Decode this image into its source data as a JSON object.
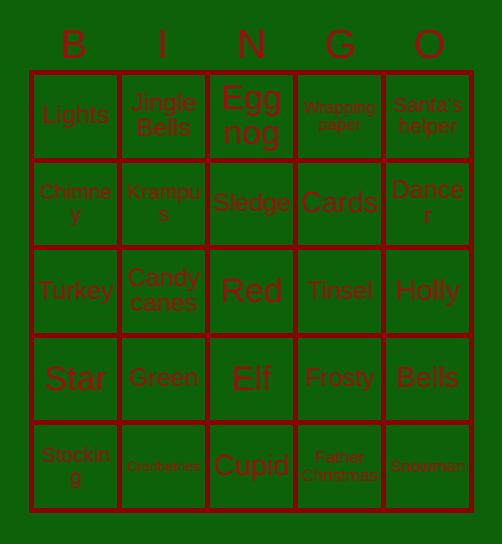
{
  "card": {
    "title": "BINGO",
    "background_color": "#0c6109",
    "border_color": "#8b0000",
    "text_color": "#9b0f0f"
  },
  "header": {
    "letters": [
      "B",
      "I",
      "N",
      "G",
      "O"
    ]
  },
  "grid": {
    "rows": 5,
    "columns": 5,
    "cells": [
      [
        {
          "label": "Lights",
          "size": "md"
        },
        {
          "label": "Jingle Bells",
          "size": "md"
        },
        {
          "label": "Egg nog",
          "size": "xl"
        },
        {
          "label": "Wrapping paper",
          "size": "xs"
        },
        {
          "label": "Santa's helper",
          "size": "sm"
        }
      ],
      [
        {
          "label": "Chimney",
          "size": "sm"
        },
        {
          "label": "Krampus",
          "size": "sm"
        },
        {
          "label": "Sledge",
          "size": "md"
        },
        {
          "label": "Cards",
          "size": "lg"
        },
        {
          "label": "Dancer",
          "size": "md"
        }
      ],
      [
        {
          "label": "Turkey",
          "size": "md"
        },
        {
          "label": "Candy canes",
          "size": "md"
        },
        {
          "label": "Red",
          "size": "xl"
        },
        {
          "label": "Tinsel",
          "size": "md"
        },
        {
          "label": "Holly",
          "size": "lg"
        }
      ],
      [
        {
          "label": "Star",
          "size": "xl"
        },
        {
          "label": "Green",
          "size": "md"
        },
        {
          "label": "Elf",
          "size": "xl"
        },
        {
          "label": "Frosty",
          "size": "md"
        },
        {
          "label": "Bells",
          "size": "lg"
        }
      ],
      [
        {
          "label": "Stocking",
          "size": "sm"
        },
        {
          "label": "Cranberries",
          "size": "xxs"
        },
        {
          "label": "Cupid",
          "size": "lg"
        },
        {
          "label": "Father Christmas",
          "size": "xs"
        },
        {
          "label": "Snowman",
          "size": "xs"
        }
      ]
    ]
  }
}
